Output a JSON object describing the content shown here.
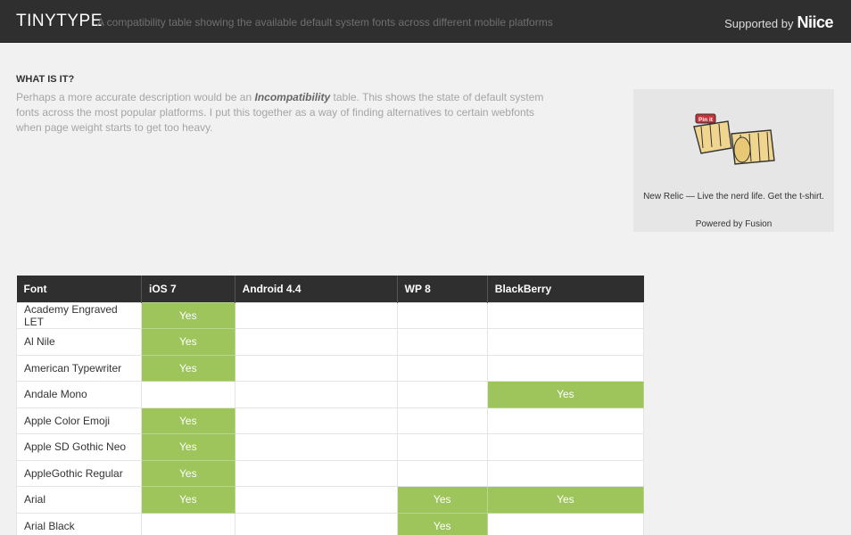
{
  "header": {
    "logo": "TINYTYPE",
    "tagline": "A compatibility table showing the available default system fonts across different mobile platforms",
    "supported_by": "Supported by",
    "brand": "Niice"
  },
  "about": {
    "title": "WHAT IS IT?",
    "text_before": "Perhaps a more accurate description would be an ",
    "text_em": "Incompatibility",
    "text_after": " table. This shows the state of default system fonts across the most popular platforms. I put this together as a way of finding alternatives to certain webfonts when page weight starts to get too heavy."
  },
  "ad": {
    "badge": "Pin it",
    "text": "New Relic — Live the nerd life. Get the t-shirt.",
    "powered": "Powered by Fusion"
  },
  "table": {
    "headers": [
      "Font",
      "iOS 7",
      "Android 4.4",
      "WP 8",
      "BlackBerry"
    ],
    "yes_label": "Yes",
    "rows": [
      {
        "font": "Academy Engraved LET",
        "support": [
          true,
          false,
          false,
          false
        ]
      },
      {
        "font": "Al Nile",
        "support": [
          true,
          false,
          false,
          false
        ]
      },
      {
        "font": "American Typewriter",
        "support": [
          true,
          false,
          false,
          false
        ]
      },
      {
        "font": "Andale Mono",
        "support": [
          false,
          false,
          false,
          true
        ]
      },
      {
        "font": "Apple Color Emoji",
        "support": [
          true,
          false,
          false,
          false
        ]
      },
      {
        "font": "Apple SD Gothic Neo",
        "support": [
          true,
          false,
          false,
          false
        ]
      },
      {
        "font": "AppleGothic Regular",
        "support": [
          true,
          false,
          false,
          false
        ]
      },
      {
        "font": "Arial",
        "support": [
          true,
          false,
          true,
          true
        ]
      },
      {
        "font": "Arial Black",
        "support": [
          false,
          false,
          true,
          false
        ]
      }
    ]
  },
  "colors": {
    "header_bg": "#2f2f2f",
    "yes_cell": "#9dc55c"
  }
}
